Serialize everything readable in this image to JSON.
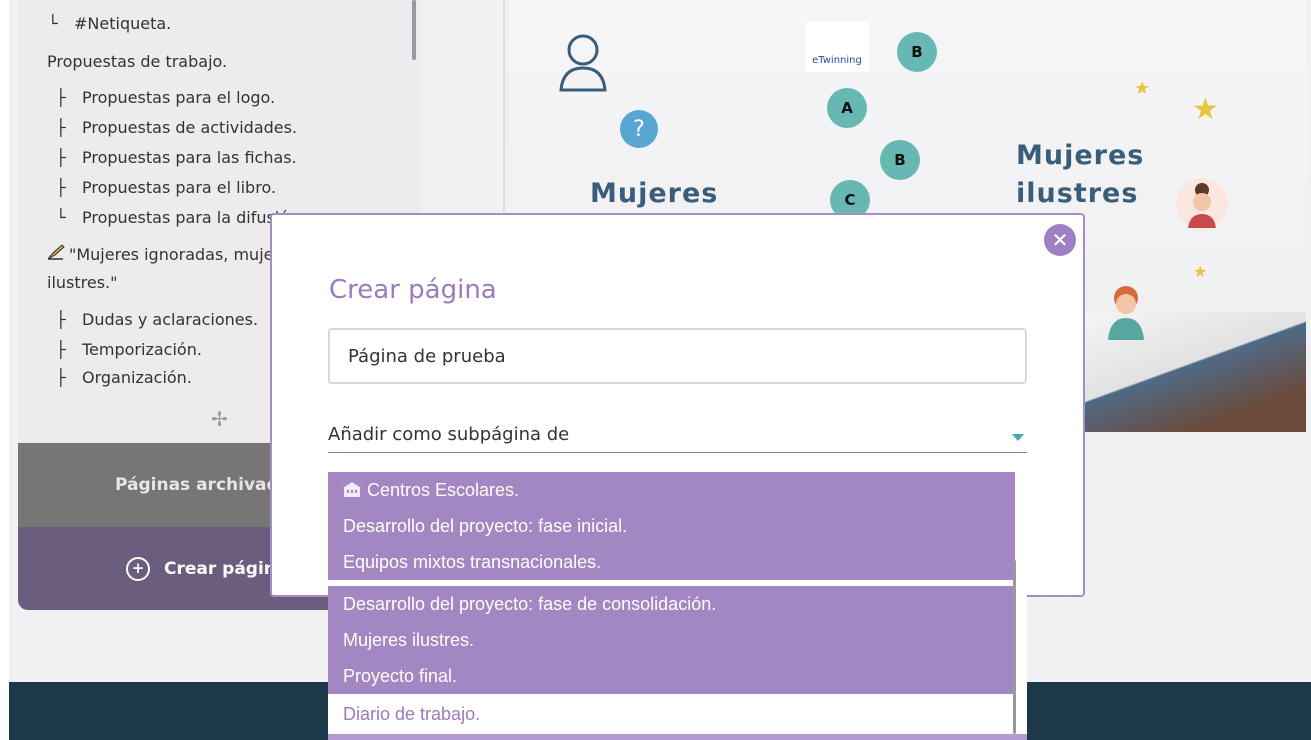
{
  "sidebar": {
    "tree": [
      {
        "label": "#Netiqueta.",
        "level": 1,
        "branch": "└"
      },
      {
        "label": "Propuestas de trabajo.",
        "level": 0
      },
      {
        "label": "Propuestas para el logo.",
        "level": 1,
        "branch": "├"
      },
      {
        "label": "Propuestas de actividades.",
        "level": 1,
        "branch": "├"
      },
      {
        "label": "Propuestas para las fichas.",
        "level": 1,
        "branch": "├"
      },
      {
        "label": "Propuestas para el libro.",
        "level": 1,
        "branch": "├"
      },
      {
        "label": "Propuestas para la difusión.",
        "level": 1,
        "branch": "└"
      },
      {
        "label": "\"Mujeres ignoradas, mujeres",
        "level": 0,
        "icon": "pencil-hand-icon"
      },
      {
        "label": "ilustres.\"",
        "level": 0
      },
      {
        "label": "Dudas y aclaraciones.",
        "level": 1,
        "branch": "├"
      },
      {
        "label": "Temporización.",
        "level": 1,
        "branch": "├"
      },
      {
        "label": "Organización.",
        "level": 1,
        "branch": "├"
      }
    ],
    "archived_label": "Páginas archivadas",
    "create_label": "Crear página"
  },
  "banner": {
    "title_left": "Mujeres",
    "title_right_1": "Mujeres",
    "title_right_2": "ilustres",
    "logo_text": "eTwinning",
    "letters": [
      "A",
      "B",
      "B",
      "C"
    ]
  },
  "modal": {
    "title": "Crear página",
    "page_name_value": "Página de prueba",
    "parent_select_label": "Añadir como subpágina de",
    "options": [
      {
        "label": "Centros Escolares.",
        "icon": "school-icon"
      },
      {
        "label": "Desarrollo del proyecto: fase inicial."
      },
      {
        "label": "Equipos mixtos transnacionales."
      },
      {
        "label": "Desarrollo del proyecto: fase de consolidación."
      },
      {
        "label": "Mujeres ilustres."
      },
      {
        "label": "Proyecto final."
      },
      {
        "label": "Diario de trabajo."
      }
    ]
  },
  "colors": {
    "accent_purple": "#a387c2",
    "title_purple": "#9c7bbd",
    "footer": "#1d3848",
    "caret_teal": "#3aa9b8"
  }
}
